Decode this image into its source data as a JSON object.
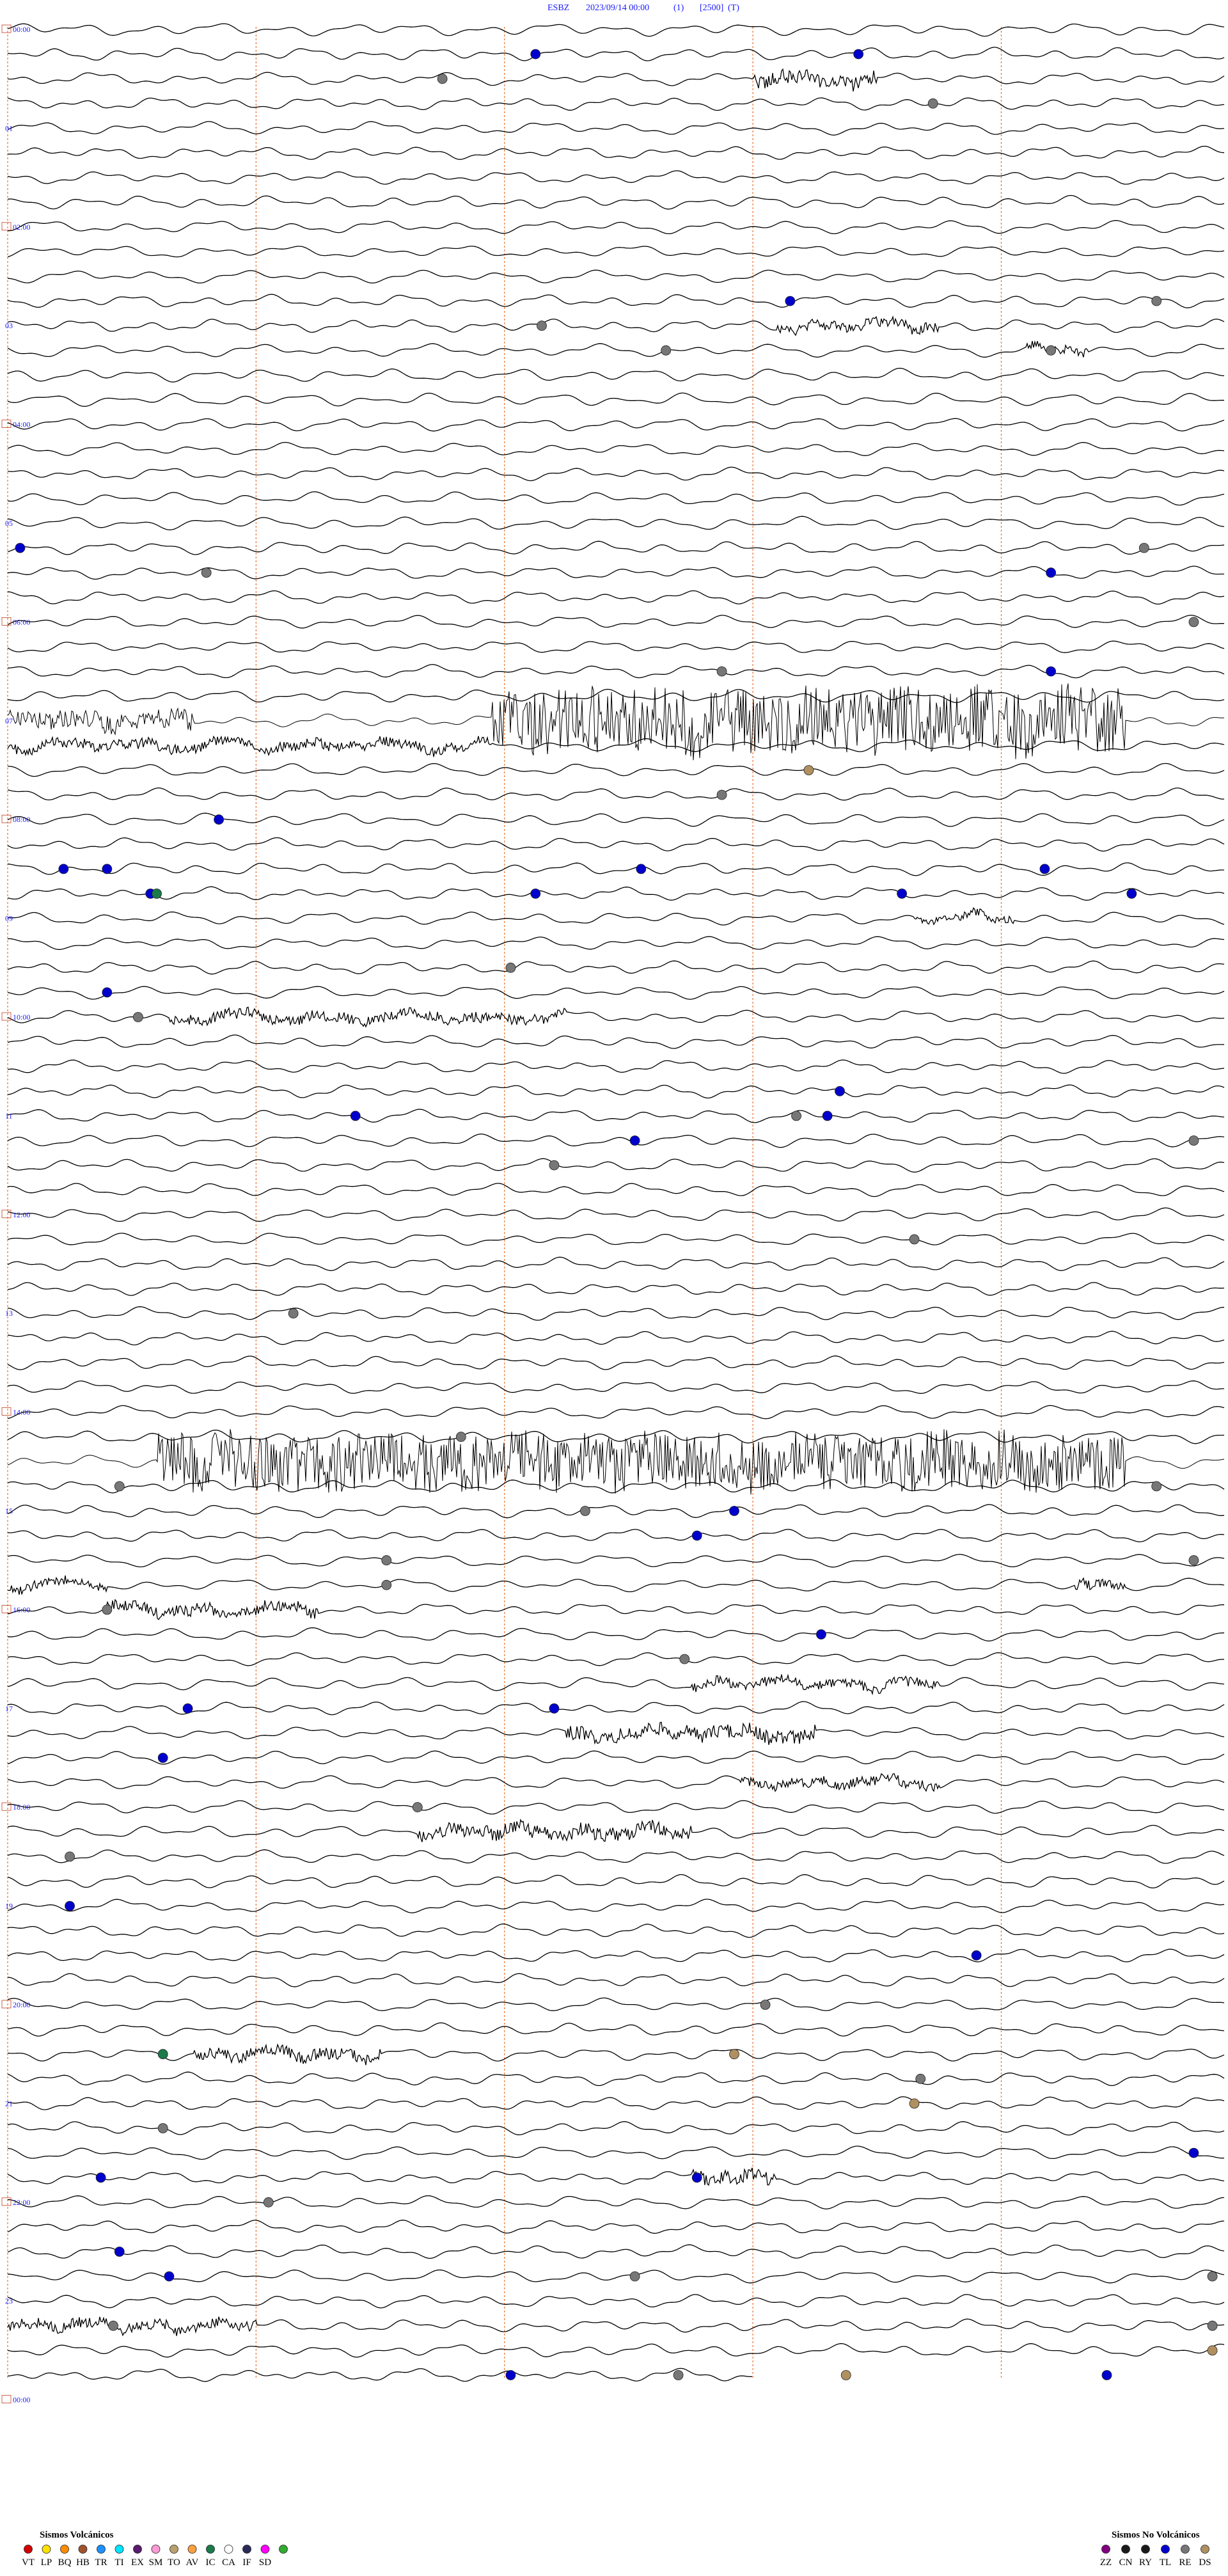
{
  "header": {
    "station": "ESBZ",
    "datetime": "2023/09/14 00:00",
    "field1": "(1)",
    "field2": "[2500]",
    "field3": "(T)"
  },
  "chart_data": {
    "type": "helicorder",
    "station": "ESBZ",
    "start": "2023/09/14 00:00",
    "traces_per_hour": 4,
    "total_traces": 96,
    "minute_markers": [
      0,
      20,
      40,
      60,
      80
    ],
    "time_labels": [
      "00:00",
      "02:00",
      "04:00",
      "06:00",
      "08:00",
      "10:00",
      "12:00",
      "14:00",
      "16:00",
      "18:00",
      "20:00",
      "22:00",
      "00:00"
    ],
    "hour_marks": [
      "01",
      "03",
      "05",
      "07",
      "09",
      "11",
      "13",
      "15",
      "17",
      "19",
      "21",
      "23"
    ],
    "colors": {
      "trace": "#000000",
      "time_label": "#1a1aff",
      "minute_grid": "#e8732a",
      "VT": "#d40000",
      "LP": "#ffe000",
      "BQ": "#ff8c00",
      "HB": "#a0522d",
      "TR": "#1e90ff",
      "TI": "#00e5ff",
      "EX": "#5a1a6e",
      "SM": "#ff9ad5",
      "TO": "#b9a06f",
      "AV": "#ffa040",
      "IC": "#1a7a4a",
      "CA": "#ffffff",
      "IF": "#2a2a5a",
      "SD": "#ff00ff",
      "XX": "#33aa33",
      "ZZ": "#800080",
      "CN": "#1a1a1a",
      "RY": "#1a1a1a",
      "TL": "#0000cc",
      "RE": "#777777",
      "DS": "#b09060"
    },
    "bursts": [
      {
        "trace": 2,
        "start_min": 60,
        "end_min": 70,
        "amp": 2.2
      },
      {
        "trace": 12,
        "start_min": 62,
        "end_min": 75,
        "amp": 1.6
      },
      {
        "trace": 13,
        "start_min": 82,
        "end_min": 87,
        "amp": 1.4
      },
      {
        "trace": 28,
        "start_min": 0,
        "end_min": 15,
        "amp": 3.0
      },
      {
        "trace": 28,
        "start_min": 39,
        "end_min": 90,
        "amp": 8.0
      },
      {
        "trace": 29,
        "start_min": 0,
        "end_min": 39,
        "amp": 1.6
      },
      {
        "trace": 36,
        "start_min": 73,
        "end_min": 81,
        "amp": 1.2
      },
      {
        "trace": 40,
        "start_min": 13,
        "end_min": 45,
        "amp": 1.6
      },
      {
        "trace": 58,
        "start_min": 12,
        "end_min": 90,
        "amp": 7.0
      },
      {
        "trace": 63,
        "start_min": 0,
        "end_min": 8,
        "amp": 1.4
      },
      {
        "trace": 63,
        "start_min": 86,
        "end_min": 90,
        "amp": 1.8
      },
      {
        "trace": 64,
        "start_min": 8,
        "end_min": 25,
        "amp": 1.8
      },
      {
        "trace": 67,
        "start_min": 55,
        "end_min": 75,
        "amp": 1.5
      },
      {
        "trace": 69,
        "start_min": 45,
        "end_min": 65,
        "amp": 2.2
      },
      {
        "trace": 71,
        "start_min": 59,
        "end_min": 75,
        "amp": 1.5
      },
      {
        "trace": 73,
        "start_min": 33,
        "end_min": 55,
        "amp": 2.2
      },
      {
        "trace": 82,
        "start_min": 15,
        "end_min": 30,
        "amp": 1.8
      },
      {
        "trace": 87,
        "start_min": 55,
        "end_min": 62,
        "amp": 2.0
      },
      {
        "trace": 93,
        "start_min": 0,
        "end_min": 20,
        "amp": 1.6
      }
    ],
    "events": [
      {
        "trace": 1,
        "minute": 42.5,
        "type": "TL"
      },
      {
        "trace": 1,
        "minute": 68.5,
        "type": "TL"
      },
      {
        "trace": 2,
        "minute": 35.0,
        "type": "RE"
      },
      {
        "trace": 3,
        "minute": 74.5,
        "type": "RE"
      },
      {
        "trace": 11,
        "minute": 63.0,
        "type": "TL"
      },
      {
        "trace": 11,
        "minute": 92.5,
        "type": "RE"
      },
      {
        "trace": 12,
        "minute": 43.0,
        "type": "RE"
      },
      {
        "trace": 13,
        "minute": 53.0,
        "type": "RE"
      },
      {
        "trace": 13,
        "minute": 84.0,
        "type": "RE"
      },
      {
        "trace": 21,
        "minute": 1.0,
        "type": "TL"
      },
      {
        "trace": 21,
        "minute": 91.5,
        "type": "RE"
      },
      {
        "trace": 22,
        "minute": 16.0,
        "type": "RE"
      },
      {
        "trace": 22,
        "minute": 84.0,
        "type": "TL"
      },
      {
        "trace": 24,
        "minute": 95.5,
        "type": "RE"
      },
      {
        "trace": 26,
        "minute": 84.0,
        "type": "TL"
      },
      {
        "trace": 26,
        "minute": 57.5,
        "type": "RE"
      },
      {
        "trace": 30,
        "minute": 64.5,
        "type": "DS"
      },
      {
        "trace": 31,
        "minute": 57.5,
        "type": "RE"
      },
      {
        "trace": 32,
        "minute": 17.0,
        "type": "TL"
      },
      {
        "trace": 34,
        "minute": 4.5,
        "type": "TL"
      },
      {
        "trace": 34,
        "minute": 8.0,
        "type": "TL"
      },
      {
        "trace": 34,
        "minute": 51.0,
        "type": "TL"
      },
      {
        "trace": 34,
        "minute": 83.5,
        "type": "TL"
      },
      {
        "trace": 35,
        "minute": 11.5,
        "type": "TL"
      },
      {
        "trace": 35,
        "minute": 42.5,
        "type": "TL"
      },
      {
        "trace": 35,
        "minute": 72.0,
        "type": "TL"
      },
      {
        "trace": 35,
        "minute": 90.5,
        "type": "TL"
      },
      {
        "trace": 35,
        "minute": 12.0,
        "type": "IC"
      },
      {
        "trace": 38,
        "minute": 40.5,
        "type": "RE"
      },
      {
        "trace": 39,
        "minute": 8.0,
        "type": "TL"
      },
      {
        "trace": 40,
        "minute": 10.5,
        "type": "RE"
      },
      {
        "trace": 43,
        "minute": 67.0,
        "type": "TL"
      },
      {
        "trace": 44,
        "minute": 28.0,
        "type": "TL"
      },
      {
        "trace": 44,
        "minute": 63.5,
        "type": "RE"
      },
      {
        "trace": 44,
        "minute": 66.0,
        "type": "TL"
      },
      {
        "trace": 45,
        "minute": 50.5,
        "type": "TL"
      },
      {
        "trace": 45,
        "minute": 95.5,
        "type": "RE"
      },
      {
        "trace": 46,
        "minute": 44.0,
        "type": "RE"
      },
      {
        "trace": 49,
        "minute": 73.0,
        "type": "RE"
      },
      {
        "trace": 52,
        "minute": 23.0,
        "type": "RE"
      },
      {
        "trace": 57,
        "minute": 36.5,
        "type": "RE"
      },
      {
        "trace": 59,
        "minute": 9.0,
        "type": "RE"
      },
      {
        "trace": 59,
        "minute": 92.5,
        "type": "RE"
      },
      {
        "trace": 60,
        "minute": 46.5,
        "type": "RE"
      },
      {
        "trace": 60,
        "minute": 58.5,
        "type": "TL"
      },
      {
        "trace": 61,
        "minute": 55.5,
        "type": "TL"
      },
      {
        "trace": 62,
        "minute": 30.5,
        "type": "RE"
      },
      {
        "trace": 62,
        "minute": 95.5,
        "type": "RE"
      },
      {
        "trace": 63,
        "minute": 30.5,
        "type": "RE"
      },
      {
        "trace": 64,
        "minute": 8.0,
        "type": "RE"
      },
      {
        "trace": 65,
        "minute": 65.5,
        "type": "TL"
      },
      {
        "trace": 66,
        "minute": 54.5,
        "type": "RE"
      },
      {
        "trace": 68,
        "minute": 14.5,
        "type": "TL"
      },
      {
        "trace": 68,
        "minute": 44.0,
        "type": "TL"
      },
      {
        "trace": 70,
        "minute": 12.5,
        "type": "TL"
      },
      {
        "trace": 72,
        "minute": 33.0,
        "type": "RE"
      },
      {
        "trace": 74,
        "minute": 5.0,
        "type": "RE"
      },
      {
        "trace": 76,
        "minute": 5.0,
        "type": "TL"
      },
      {
        "trace": 78,
        "minute": 78.0,
        "type": "TL"
      },
      {
        "trace": 80,
        "minute": 61.0,
        "type": "RE"
      },
      {
        "trace": 82,
        "minute": 58.5,
        "type": "DS"
      },
      {
        "trace": 82,
        "minute": 12.5,
        "type": "IC"
      },
      {
        "trace": 83,
        "minute": 73.5,
        "type": "RE"
      },
      {
        "trace": 84,
        "minute": 73.0,
        "type": "DS"
      },
      {
        "trace": 85,
        "minute": 12.5,
        "type": "RE"
      },
      {
        "trace": 86,
        "minute": 95.5,
        "type": "TL"
      },
      {
        "trace": 87,
        "minute": 55.5,
        "type": "TL"
      },
      {
        "trace": 87,
        "minute": 7.5,
        "type": "TL"
      },
      {
        "trace": 88,
        "minute": 21.0,
        "type": "RE"
      },
      {
        "trace": 90,
        "minute": 9.0,
        "type": "TL"
      },
      {
        "trace": 91,
        "minute": 13.0,
        "type": "TL"
      },
      {
        "trace": 91,
        "minute": 50.5,
        "type": "RE"
      },
      {
        "trace": 91,
        "minute": 97.0,
        "type": "RE"
      },
      {
        "trace": 93,
        "minute": 8.5,
        "type": "RE"
      },
      {
        "trace": 93,
        "minute": 97.0,
        "type": "RE"
      },
      {
        "trace": 94,
        "minute": 97.0,
        "type": "DS"
      },
      {
        "trace": 95,
        "minute": 40.5,
        "type": "TL"
      },
      {
        "trace": 95,
        "minute": 54.0,
        "type": "RE"
      },
      {
        "trace": 95,
        "minute": 67.5,
        "type": "DS"
      },
      {
        "trace": 95,
        "minute": 88.5,
        "type": "TL"
      }
    ]
  },
  "legend_volcanic": {
    "title": "Sismos Volcánicos",
    "items": [
      {
        "code": "VT",
        "color": "#d40000"
      },
      {
        "code": "LP",
        "color": "#ffe000"
      },
      {
        "code": "BQ",
        "color": "#ff8c00"
      },
      {
        "code": "HB",
        "color": "#a0522d"
      },
      {
        "code": "TR",
        "color": "#1e90ff"
      },
      {
        "code": "TI",
        "color": "#00e5ff"
      },
      {
        "code": "EX",
        "color": "#5a1a6e"
      },
      {
        "code": "SM",
        "color": "#ff9ad5"
      },
      {
        "code": "TO",
        "color": "#b9a06f"
      },
      {
        "code": "AV",
        "color": "#ffa040"
      },
      {
        "code": "IC",
        "color": "#1a7a4a"
      },
      {
        "code": "CA",
        "color": "#ffffff"
      },
      {
        "code": "IF",
        "color": "#2a2a5a"
      },
      {
        "code": "SD",
        "color": "#ff00ff"
      },
      {
        "code": "",
        "color": "#33aa33"
      }
    ]
  },
  "legend_nonvolcanic": {
    "title": "Sismos No Volcánicos",
    "items": [
      {
        "code": "ZZ",
        "color": "#800080"
      },
      {
        "code": "CN",
        "color": "#1a1a1a"
      },
      {
        "code": "RY",
        "color": "#1a1a1a"
      },
      {
        "code": "TL",
        "color": "#0000cc"
      },
      {
        "code": "RE",
        "color": "#777777"
      },
      {
        "code": "DS",
        "color": "#b09060"
      }
    ]
  }
}
